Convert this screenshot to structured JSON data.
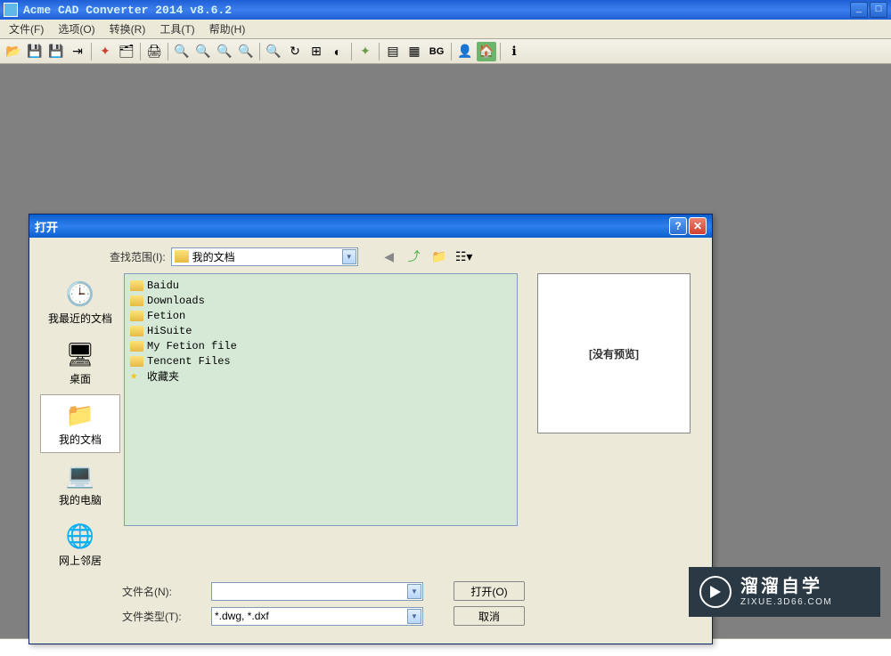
{
  "window": {
    "title": "Acme CAD Converter 2014 v8.6.2"
  },
  "menu": {
    "file": "文件(F)",
    "options": "选项(O)",
    "convert": "转换(R)",
    "tools": "工具(T)",
    "help": "帮助(H)"
  },
  "toolbar": {
    "bg_label": "BG"
  },
  "dialog": {
    "title": "打开",
    "lookin_label": "查找范围(I):",
    "lookin_value": "我的文档",
    "places": {
      "recent": "我最近的文档",
      "desktop": "桌面",
      "documents": "我的文档",
      "computer": "我的电脑",
      "network": "网上邻居"
    },
    "files": [
      {
        "name": "Baidu",
        "type": "folder"
      },
      {
        "name": "Downloads",
        "type": "folder"
      },
      {
        "name": "Fetion",
        "type": "folder"
      },
      {
        "name": "HiSuite",
        "type": "folder"
      },
      {
        "name": "My Fetion file",
        "type": "folder"
      },
      {
        "name": "Tencent Files",
        "type": "folder"
      },
      {
        "name": "收藏夹",
        "type": "favorites"
      }
    ],
    "preview_text": "[没有预览]",
    "filename_label": "文件名(N):",
    "filename_value": "",
    "filetype_label": "文件类型(T):",
    "filetype_value": "*.dwg, *.dxf",
    "open_btn": "打开(O)",
    "cancel_btn": "取消"
  },
  "watermark": {
    "cn": "溜溜自学",
    "en": "ZIXUE.3D66.COM"
  }
}
